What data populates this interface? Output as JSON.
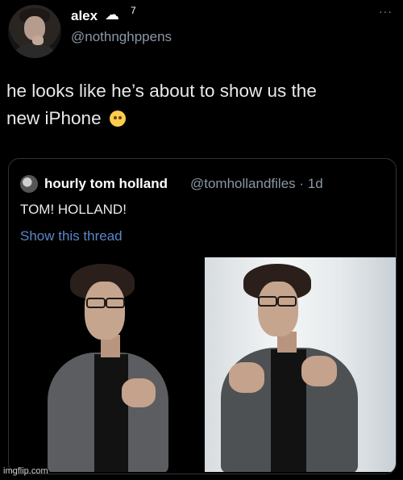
{
  "tweet": {
    "author_name": "alex",
    "status_count": "7",
    "handle": "@nothnghppens",
    "more": "···",
    "text_line1": "he looks like he’s about to show us the",
    "text_line2": "new iPhone",
    "emoji": "crying-face-emoji"
  },
  "quote": {
    "author_name": "hourly tom holland",
    "handle_time": "@tomhollandfiles · 1d",
    "text": "TOM! HOLLAND!",
    "link": "Show this thread"
  },
  "colors": {
    "background": "#000000",
    "text": "#e7e9ea",
    "secondary": "#8b98a5",
    "link": "#5b87c9",
    "border": "#2f3336"
  },
  "watermark": "imgflip.com"
}
